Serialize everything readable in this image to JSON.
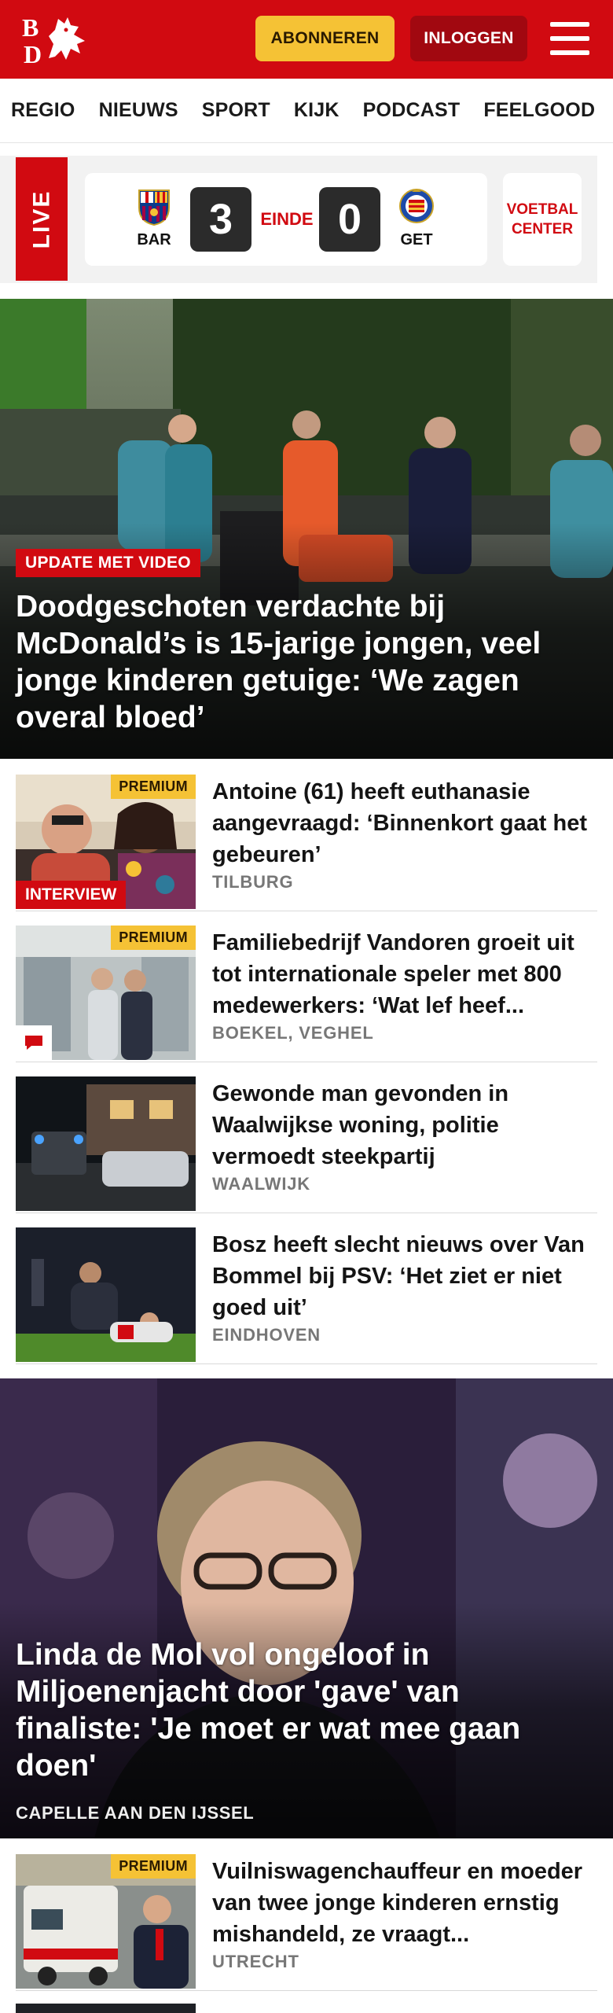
{
  "header": {
    "brand_color": "#d10a11",
    "subscribe_label": "ABONNEREN",
    "login_label": "INLOGGEN",
    "logo_letters": "BD",
    "menu_icon": "hamburger-icon"
  },
  "nav": {
    "items": [
      "REGIO",
      "NIEUWS",
      "SPORT",
      "KIJK",
      "PODCAST",
      "FEELGOOD"
    ]
  },
  "live": {
    "label": "LIVE",
    "home_team": "BAR",
    "away_team": "GET",
    "home_score": "3",
    "away_score": "0",
    "status": "EINDE",
    "voetbal_center": "VOETBAL CENTER"
  },
  "hero1": {
    "label": "UPDATE MET VIDEO",
    "title": "Doodgeschoten verdachte bij McDonald’s is 15-jarige jongen, veel jonge kinderen getuige: ‘We zagen overal bloed’"
  },
  "articles": [
    {
      "title": "Antoine (61) heeft euthanasie aangevraagd: ‘Binnenkort gaat het gebeuren’",
      "location": "TILBURG",
      "premium": "PREMIUM",
      "tag": "INTERVIEW"
    },
    {
      "title": "Familiebedrijf Vandoren groeit uit tot internationale speler met 800 medewerkers: ‘Wat lef heef...",
      "location": "BOEKEL, VEGHEL",
      "premium": "PREMIUM"
    },
    {
      "title": "Gewonde man gevonden in Waalwijkse woning, politie vermoedt steekpartij",
      "location": "WAALWIJK"
    },
    {
      "title": "Bosz heeft slecht nieuws over Van Bommel bij PSV: ‘Het ziet er niet goed uit’",
      "location": "EINDHOVEN"
    }
  ],
  "hero2": {
    "title": "Linda de Mol vol ongeloof in Miljoenenjacht door 'gave' van finaliste: 'Je moet er wat mee gaan doen'",
    "location": "CAPELLE AAN DEN IJSSEL"
  },
  "articles2": [
    {
      "title": "Vuilniswagenchauffeur en moeder van twee jonge kinderen ernstig mishandeld, ze vraagt...",
      "location": "UTRECHT",
      "premium": "PREMIUM"
    }
  ]
}
